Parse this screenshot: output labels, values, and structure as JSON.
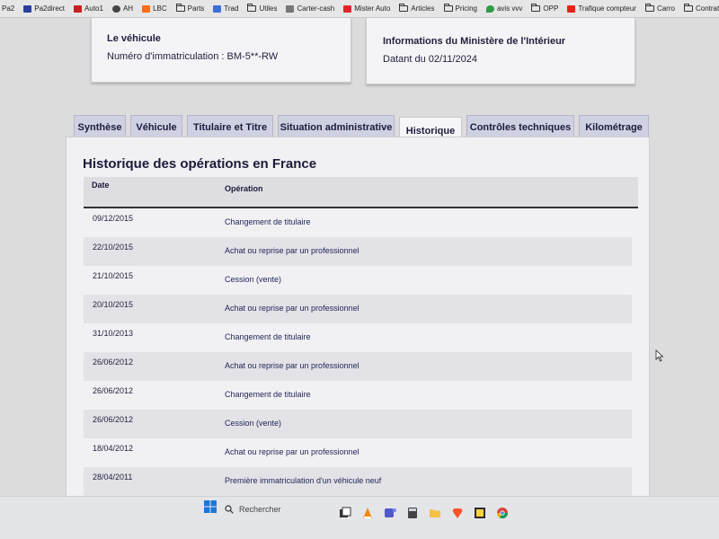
{
  "bookmarks": [
    {
      "label": "Pa2",
      "icon": "bookmark-icon"
    },
    {
      "label": "Pa2direct",
      "icon": "flag-icon"
    },
    {
      "label": "Auto1",
      "icon": "car-icon"
    },
    {
      "label": "AH",
      "icon": "circle-icon"
    },
    {
      "label": "LBC",
      "icon": "site-icon"
    },
    {
      "label": "Parts",
      "icon": "folder-icon"
    },
    {
      "label": "Trad",
      "icon": "translate-icon"
    },
    {
      "label": "Utiles",
      "icon": "folder-icon"
    },
    {
      "label": "Carter-cash",
      "icon": "link-icon"
    },
    {
      "label": "Mister Auto",
      "icon": "site-icon"
    },
    {
      "label": "Articles",
      "icon": "folder-icon"
    },
    {
      "label": "Pricing",
      "icon": "folder-icon"
    },
    {
      "label": "avis vvv",
      "icon": "map-pin-icon"
    },
    {
      "label": "OPP",
      "icon": "folder-icon"
    },
    {
      "label": "Trafique compteur",
      "icon": "youtube-icon"
    },
    {
      "label": "Carro",
      "icon": "folder-icon"
    },
    {
      "label": "Contrats Dist",
      "icon": "folder-icon"
    }
  ],
  "vehicle_card": {
    "title": "Le véhicule",
    "registration": "Numéro d'immatriculation : BM-5**-RW"
  },
  "ministry_card": {
    "title": "Informations du Ministère de l'Intérieur",
    "date": "Datant du 02/11/2024"
  },
  "tabs": [
    {
      "label": "Synthèse",
      "active": false
    },
    {
      "label": "Véhicule",
      "active": false
    },
    {
      "label": "Titulaire et Titre",
      "active": false
    },
    {
      "label": "Situation administrative",
      "active": false
    },
    {
      "label": "Historique",
      "active": true
    },
    {
      "label": "Contrôles techniques",
      "active": false
    },
    {
      "label": "Kilométrage",
      "active": false
    }
  ],
  "history": {
    "title": "Historique des opérations en France",
    "columns": {
      "date": "Date",
      "operation": "Opération"
    },
    "rows": [
      {
        "date": "09/12/2015",
        "operation": "Changement de titulaire"
      },
      {
        "date": "22/10/2015",
        "operation": "Achat ou reprise par un professionnel"
      },
      {
        "date": "21/10/2015",
        "operation": "Cession (vente)"
      },
      {
        "date": "20/10/2015",
        "operation": "Achat ou reprise par un professionnel"
      },
      {
        "date": "31/10/2013",
        "operation": "Changement de titulaire"
      },
      {
        "date": "26/06/2012",
        "operation": "Achat ou reprise par un professionnel"
      },
      {
        "date": "26/06/2012",
        "operation": "Changement de titulaire"
      },
      {
        "date": "26/06/2012",
        "operation": "Cession (vente)"
      },
      {
        "date": "18/04/2012",
        "operation": "Achat ou reprise par un professionnel"
      },
      {
        "date": "28/04/2011",
        "operation": "Première immatriculation d'un véhicule neuf"
      }
    ]
  },
  "taskbar": {
    "search_placeholder": "Rechercher",
    "icons": [
      "windows-start-icon",
      "search-icon",
      "task-view-icon",
      "vlc-icon",
      "teams-icon",
      "calculator-icon",
      "file-explorer-icon",
      "brave-icon",
      "sticky-notes-icon",
      "chrome-icon"
    ]
  },
  "colors": {
    "tab_bg": "#cfd0e2",
    "tab_active_bg": "#f6f6f8",
    "text_dark": "#1a1a3a",
    "row_alt": "#e3e3e7"
  }
}
